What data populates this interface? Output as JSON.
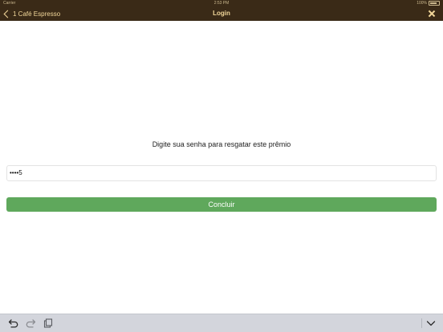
{
  "status_bar": {
    "carrier": "Carrier",
    "time": "2:53 PM",
    "battery": "100%"
  },
  "nav": {
    "back_label": "1 Café Espresso",
    "title": "Login",
    "close_icon": "close-icon",
    "back_icon": "chevron-left-icon"
  },
  "main": {
    "prompt": "Digite sua senha para resgatar este prêmio",
    "password_value": "••••5",
    "submit_label": "Concluir"
  },
  "keyboard_toolbar": {
    "undo_icon": "undo-icon",
    "redo_icon": "redo-icon",
    "paste_icon": "paste-icon",
    "dismiss_icon": "chevron-down-icon"
  },
  "colors": {
    "nav_background": "#3a2a17",
    "nav_text": "#f2d79a",
    "submit_background": "#5fa85c",
    "toolbar_background": "#d3d5dc"
  }
}
